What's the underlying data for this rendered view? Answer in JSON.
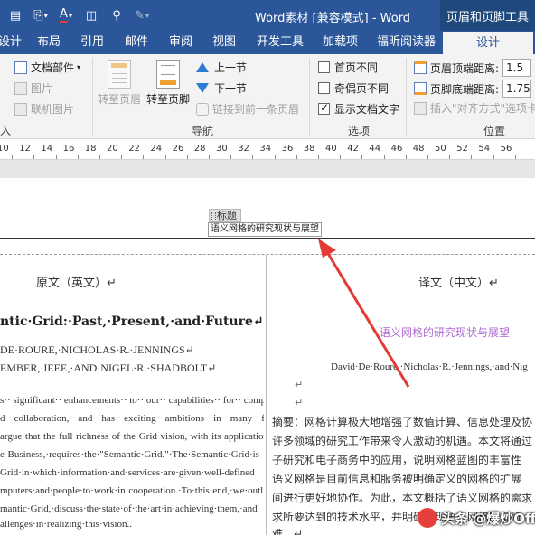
{
  "window": {
    "title": "Word素材 [兼容模式] - Word",
    "context_tab": "页眉和页脚工具"
  },
  "qat": [
    "save-icon",
    "format-painter-icon",
    "font-color-icon",
    "columns-icon",
    "search-icon",
    "pen-icon"
  ],
  "tabs": [
    "设计",
    "布局",
    "引用",
    "邮件",
    "审阅",
    "视图",
    "开发工具",
    "加载项",
    "福昕阅读器",
    "设计"
  ],
  "ribbon": {
    "insert_group": {
      "doc_parts": "文档部件",
      "pictures": "图片",
      "online_pictures": "联机图片",
      "group_label": "入"
    },
    "nav_group": {
      "goto_header": "转至页眉",
      "goto_footer": "转至页脚",
      "prev_section": "上一节",
      "next_section": "下一节",
      "link_previous": "链接到前一条页眉",
      "group_label": "导航"
    },
    "options_group": {
      "different_first": "首页不同",
      "different_odd_even": "奇偶页不同",
      "show_doc_text": "显示文档文字",
      "group_label": "选项",
      "show_doc_text_checked": true
    },
    "position_group": {
      "header_from_top": "页眉顶端距离:",
      "header_value": "1.5",
      "footer_from_bottom": "页脚底端距离:",
      "footer_value": "1.75",
      "insert_align_tab": "插入\"对齐方式\"选项卡",
      "group_label": "位置"
    }
  },
  "ruler": [
    "10",
    "12",
    "14",
    "16",
    "18",
    "20",
    "22",
    "24",
    "26",
    "28",
    "30",
    "32",
    "34",
    "36",
    "38",
    "40",
    "42",
    "44",
    "46",
    "48",
    "50",
    "52",
    "54",
    "56"
  ],
  "document": {
    "header_tag": "标题",
    "header_field": "语义网格的研究现状与展望",
    "table": {
      "col_left_header": "原文（英文）↵",
      "col_right_header": "译文（中文）↵",
      "en_title": "ntic·Grid:·Past,·Present,·and·Future↵",
      "en_authors": [
        "DE·ROURE,·NICHOLAS·R.·JENNINGS↵",
        "EMBER,·IEEE,·AND·NIGEL·R.·SHADBOLT↵"
      ],
      "en_abstract": [
        "s·· significant·· enhancements·· to·· our·· capabilities·· for·· computation,",
        "d·· collaboration,·· and·· has·· exciting·· ambitions·· in·· many·· fields·· of",
        "argue·that·the·full·richness·of·the·Grid·vision,·with·its·application",
        "e-Business,·requires·the·\"Semantic·Grid.\"·The·Semantic·Grid·is",
        "Grid·in·which·information·and·services·are·given·well-defined",
        "mputers·and·people·to·work·in·cooperation.·To·this·end,·we·outline",
        "mantic·Grid,·discuss·the·state·of·the·art·in·achieving·them,·and",
        "allenges·in·realizing·this·vision.."
      ],
      "cn_title": "语义网格的研究现状与展望",
      "cn_authors": "David·De·Roure,·Nicholas·R.·Jennings,·and·Nig",
      "para_mark": "↵",
      "cn_abstract": [
        "摘要：网格计算极大地增强了数值计算、信息处理及协",
        "许多领域的研究工作带来令人激动的机遇。本文将通过",
        "子研究和电子商务中的应用，说明网格蓝图的丰富性",
        "语义网格是目前信息和服务被明确定义的网格的扩展",
        "间进行更好地协作。为此，本文概括了语义网格的需求",
        "求所要达到的技术水平，并明确实现语义网格愿景所",
        "难。↵"
      ]
    }
  },
  "watermark": "头条 @爆炒Office",
  "colors": {
    "titlebar": "#2b579a",
    "context_tab": "#1f497d",
    "ribbon_bg": "#f3f3f3",
    "cn_title": "#b06bd0",
    "arrow": "#e53935"
  }
}
